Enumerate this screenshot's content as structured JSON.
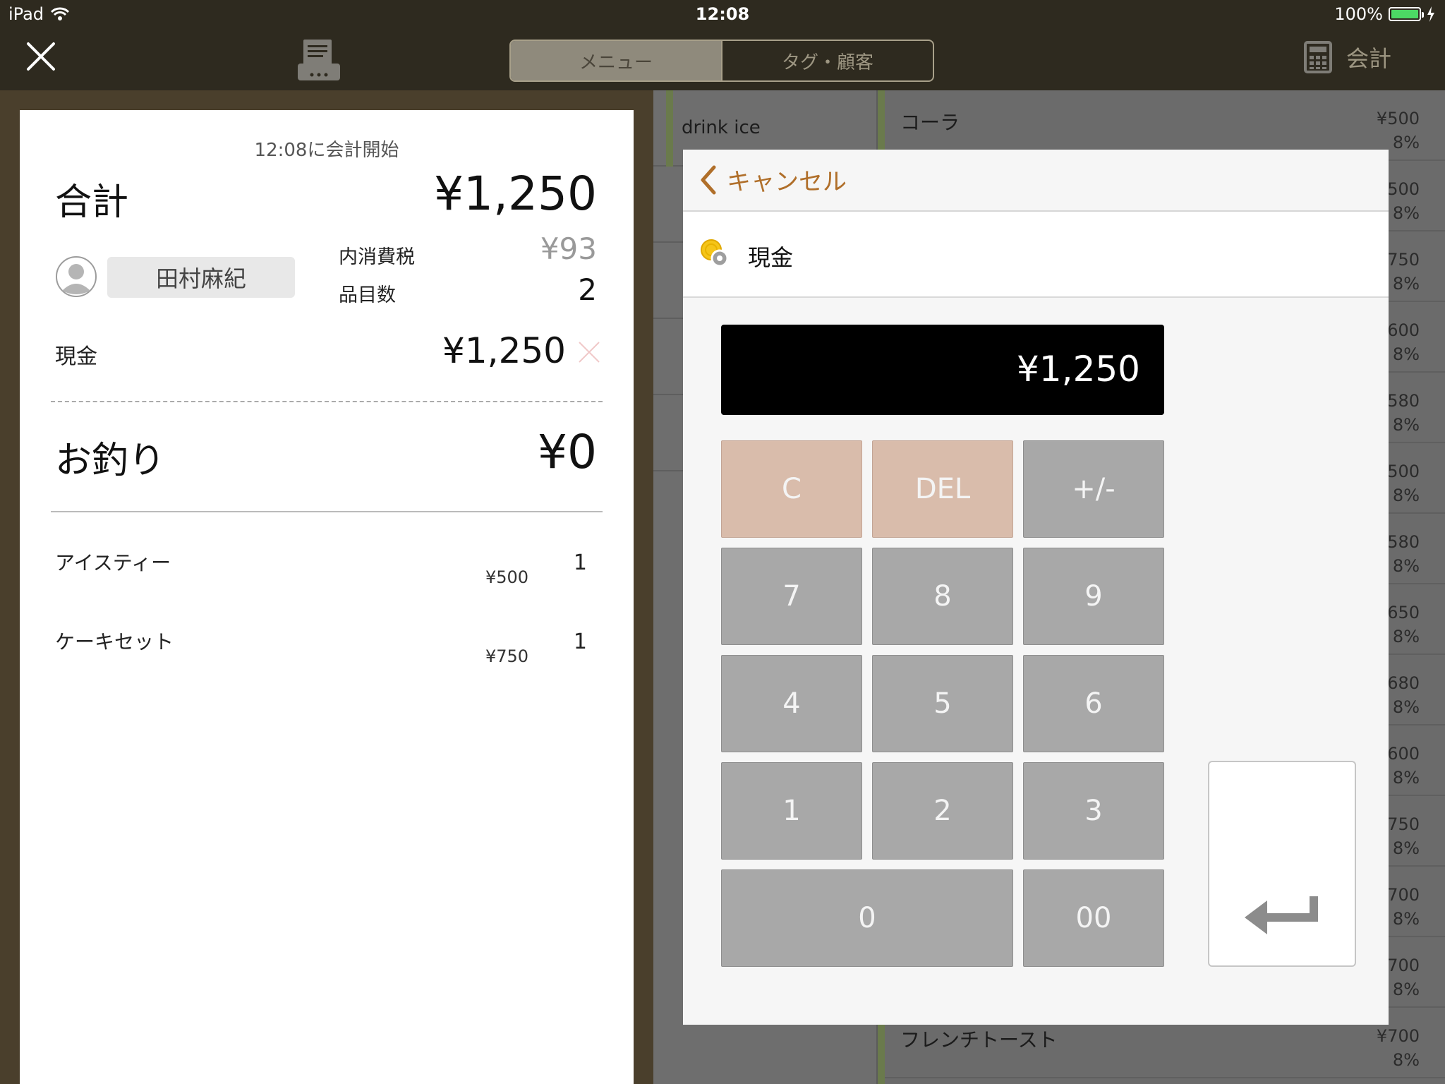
{
  "status_bar": {
    "device": "iPad",
    "time": "12:08",
    "battery": "100%"
  },
  "nav": {
    "segments": [
      "メニュー",
      "タグ・顧客"
    ],
    "active_segment": 0,
    "checkout_label": "会計"
  },
  "menu_bg": {
    "category": "drink ice",
    "items": [
      {
        "name": "コーラ",
        "price": "¥500",
        "tax": "8%"
      },
      {
        "name": "",
        "price": "500",
        "tax": "8%"
      },
      {
        "name": "",
        "price": "750",
        "tax": "8%"
      },
      {
        "name": "",
        "price": "600",
        "tax": "8%"
      },
      {
        "name": "",
        "price": "580",
        "tax": "8%"
      },
      {
        "name": "",
        "price": "500",
        "tax": "8%"
      },
      {
        "name": "",
        "price": "580",
        "tax": "8%"
      },
      {
        "name": "",
        "price": "650",
        "tax": "8%"
      },
      {
        "name": "",
        "price": "680",
        "tax": "8%"
      },
      {
        "name": "",
        "price": "600",
        "tax": "8%"
      },
      {
        "name": "",
        "price": "750",
        "tax": "8%"
      },
      {
        "name": "",
        "price": "700",
        "tax": "8%"
      },
      {
        "name": "",
        "price": "700",
        "tax": "8%"
      },
      {
        "name": "フレンチトースト",
        "price": "¥700",
        "tax": "8%"
      }
    ]
  },
  "receipt": {
    "start_time": "12:08に会計開始",
    "total_label": "合計",
    "total_value": "¥1,250",
    "customer_name": "田村麻紀",
    "tax_label": "内消費税",
    "tax_value": "¥93",
    "count_label": "品目数",
    "count_value": "2",
    "payment_label": "現金",
    "payment_value": "¥1,250",
    "change_label": "お釣り",
    "change_value": "¥0",
    "items": [
      {
        "name": "アイスティー",
        "price": "¥500",
        "qty": "1"
      },
      {
        "name": "ケーキセット",
        "price": "¥750",
        "qty": "1"
      }
    ]
  },
  "modal": {
    "cancel_label": "キャンセル",
    "method_label": "現金",
    "display_value": "¥1,250",
    "keys": {
      "clear": "C",
      "del": "DEL",
      "sign": "+/-",
      "k7": "7",
      "k8": "8",
      "k9": "9",
      "k4": "4",
      "k5": "5",
      "k6": "6",
      "k1": "1",
      "k2": "2",
      "k3": "3",
      "k0": "0",
      "k00": "00"
    }
  }
}
